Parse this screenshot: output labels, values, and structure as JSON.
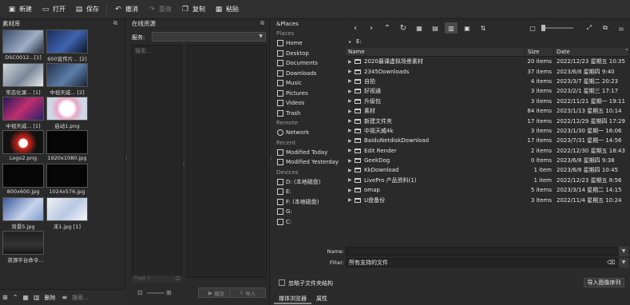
{
  "toolbar": {
    "new": "新建",
    "open": "打开",
    "save": "保存",
    "undo": "撤消",
    "redo": "重做",
    "copy": "复制",
    "paste": "粘贴"
  },
  "library": {
    "title": "素材库",
    "thumbs": [
      {
        "label": "DSC0012...[1]",
        "icon": "image-thumbnail"
      },
      {
        "label": "600宣传片... [2]",
        "icon": "image-thumbnail"
      },
      {
        "label": "常态化课... [1]",
        "icon": "image-thumbnail"
      },
      {
        "label": "中视天威... [2]",
        "icon": "image-thumbnail"
      },
      {
        "label": "中视天威... [1]",
        "icon": "image-thumbnail"
      },
      {
        "label": "启动1.png",
        "icon": "image-thumbnail"
      },
      {
        "label": "Logo2.png",
        "icon": "image-thumbnail"
      },
      {
        "label": "1920x1080.jpg",
        "icon": "image-thumbnail"
      },
      {
        "label": "800x600.jpg",
        "icon": "image-thumbnail"
      },
      {
        "label": "1024x576.jpg",
        "icon": "image-thumbnail"
      },
      {
        "label": "背景5.jpg",
        "icon": "image-thumbnail"
      },
      {
        "label": "未1.jpg [1]",
        "icon": "image-thumbnail"
      },
      {
        "label": "资源平台命令...",
        "icon": "image-thumbnail"
      }
    ],
    "delete_label": "删除",
    "search_placeholder": "搜索..."
  },
  "online": {
    "title": "在线资源",
    "service_label": "服务:",
    "search_placeholder": "搜索...",
    "page_label": "Page 1",
    "preview_label": "播放",
    "import_label": "导入"
  },
  "places": {
    "header": "&Places",
    "sections": [
      {
        "title": "Places",
        "items": [
          "Home",
          "Desktop",
          "Documents",
          "Downloads",
          "Music",
          "Pictures",
          "Videos",
          "Trash"
        ]
      },
      {
        "title": "Remote",
        "items": [
          "Network"
        ]
      },
      {
        "title": "Recent",
        "items": [
          "Modified Today",
          "Modified Yesterday"
        ]
      },
      {
        "title": "Devices",
        "items": [
          "D: (本地磁盘)",
          "E:",
          "F: (本地磁盘)",
          "G:",
          "C:"
        ]
      }
    ]
  },
  "files": {
    "path": "E:",
    "columns": {
      "name": "Name",
      "size": "Size",
      "date": "Date"
    },
    "rows": [
      {
        "name": "2020最课虚拟场景素材",
        "size": "20 items",
        "date": "2022/12/23 星期五 10:35"
      },
      {
        "name": "2345Downloads",
        "size": "37 items",
        "date": "2023/6/8 星期四 9:40"
      },
      {
        "name": "自拍",
        "size": "4 items",
        "date": "2023/3/7 星期二 20:23"
      },
      {
        "name": "好视通",
        "size": "3 items",
        "date": "2023/2/1 星期三 17:17"
      },
      {
        "name": "升级包",
        "size": "3 items",
        "date": "2022/11/21 星期一 19:11"
      },
      {
        "name": "素材",
        "size": "84 items",
        "date": "2023/1/13 星期五 10:14"
      },
      {
        "name": "新建文件夹",
        "size": "17 items",
        "date": "2022/12/29 星期四 17:29"
      },
      {
        "name": "中视天威4k",
        "size": "3 items",
        "date": "2023/1/30 星期一 16:06"
      },
      {
        "name": "BaiduNetdiskDownload",
        "size": "17 items",
        "date": "2023/7/31 星期一 14:56"
      },
      {
        "name": "Edit Render",
        "size": "2 items",
        "date": "2022/12/30 星期五 18:43"
      },
      {
        "name": "GeekDog",
        "size": "0 items",
        "date": "2023/6/8 星期四 9:38"
      },
      {
        "name": "KkDownload",
        "size": "1 item",
        "date": "2023/6/8 星期四 10:45"
      },
      {
        "name": "LivePro 产品资料(1)",
        "size": "1 item",
        "date": "2022/12/23 星期五 8:56"
      },
      {
        "name": "omap",
        "size": "5 items",
        "date": "2023/3/14 星期二 14:15"
      },
      {
        "name": "U盘备份",
        "size": "3 items",
        "date": "2022/11/4 星期五 10:24"
      }
    ],
    "name_label": "Name:",
    "name_value": "",
    "filter_label": "Filter:",
    "filter_value": "所有支持的文件",
    "ignore_label": "忽略子文件夹结构",
    "import_sequence_label": "导入图像序列"
  },
  "tabs": [
    "媒体浏览器",
    "属性"
  ]
}
